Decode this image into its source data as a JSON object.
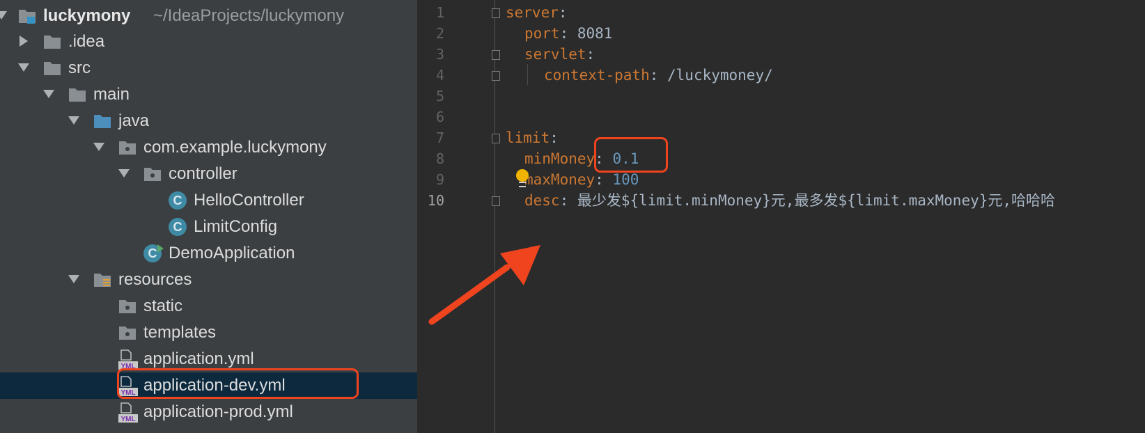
{
  "project_tree": {
    "root": {
      "label": "luckymony",
      "path": "~/IdeaProjects/luckymony"
    },
    "items": [
      {
        "label": ".idea"
      },
      {
        "label": "src"
      },
      {
        "label": "main"
      },
      {
        "label": "java"
      },
      {
        "label": "com.example.luckymony"
      },
      {
        "label": "controller"
      },
      {
        "label": "HelloController",
        "icon_text": "C"
      },
      {
        "label": "LimitConfig",
        "icon_text": "C"
      },
      {
        "label": "DemoApplication",
        "icon_text": "C"
      },
      {
        "label": "resources"
      },
      {
        "label": "static"
      },
      {
        "label": "templates"
      },
      {
        "label": "application.yml",
        "icon_text": "YML"
      },
      {
        "label": "application-dev.yml",
        "icon_text": "YML",
        "selected": true
      },
      {
        "label": "application-prod.yml",
        "icon_text": "YML"
      }
    ]
  },
  "editor": {
    "line_numbers": [
      "1",
      "2",
      "3",
      "4",
      "5",
      "6",
      "7",
      "8",
      "9",
      "10"
    ],
    "current_line": "10",
    "lines": [
      {
        "key": "server",
        "sep": ":",
        "value": ""
      },
      {
        "key": "port",
        "sep": ": ",
        "value": "8081"
      },
      {
        "key": "servlet",
        "sep": ":",
        "value": ""
      },
      {
        "key": "context-path",
        "sep": ": ",
        "value": "/luckymoney/"
      },
      {
        "key": "",
        "sep": "",
        "value": ""
      },
      {
        "key": "",
        "sep": "",
        "value": ""
      },
      {
        "key": "limit",
        "sep": ":",
        "value": ""
      },
      {
        "key": "minMoney",
        "sep": ": ",
        "value": "0.1"
      },
      {
        "key": "maxMoney",
        "sep": ": ",
        "value": "100"
      },
      {
        "key": "desc",
        "sep": ": ",
        "value": "最少发${limit.minMoney}元,最多发${limit.maxMoney}元,哈哈哈"
      }
    ]
  },
  "colors": {
    "tree_bg": "#3c3f41",
    "editor_bg": "#2b2b2b",
    "yaml_key": "#cc7832",
    "number": "#6897bb",
    "annotation": "#f0441f",
    "selection": "#0d293e"
  },
  "icons": [
    "module-folder-icon",
    "folder-icon",
    "source-folder-icon",
    "package-icon",
    "class-icon",
    "run-class-icon",
    "resources-folder-icon",
    "yml-file-icon",
    "lightbulb-icon",
    "fold-marker-icon",
    "chevron-right-icon",
    "chevron-down-icon"
  ]
}
